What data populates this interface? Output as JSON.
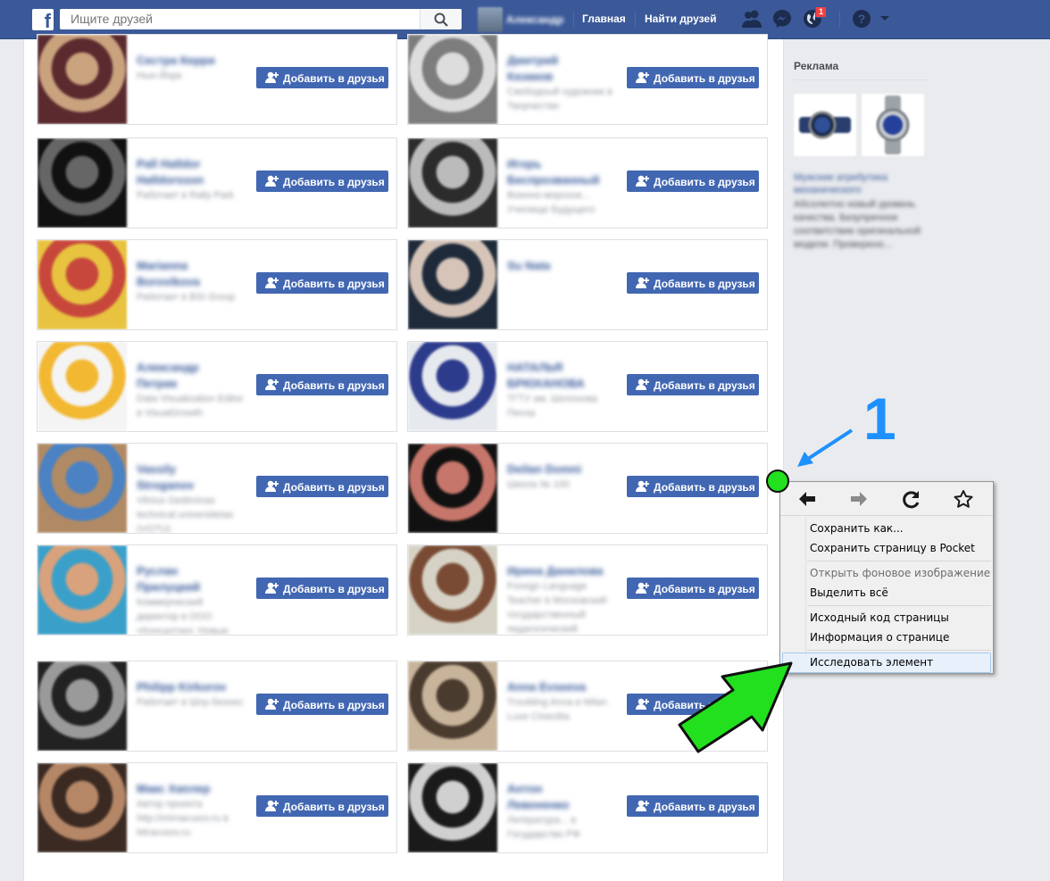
{
  "header": {
    "logo_letter": "f",
    "search_placeholder": "Ищите друзей",
    "profile_name": "Александр",
    "nav_home": "Главная",
    "nav_find_friends": "Найти друзей",
    "notifications_count": "1"
  },
  "add_button_label": "Добавить в друзья",
  "people_left": [
    {
      "name": "Сестра Керри",
      "subtitle": "Нью-Йорк",
      "photo_colors": [
        "#5b2a2e",
        "#c9a27e"
      ]
    },
    {
      "name": "Pall Halldor Halldorsson",
      "subtitle": "Работает в Rally Park",
      "photo_colors": [
        "#111111",
        "#666666"
      ]
    },
    {
      "name": "Marianna Borovikova",
      "subtitle": "Работает в BSI Group",
      "photo_colors": [
        "#e7c33f",
        "#c8473c"
      ]
    },
    {
      "name": "Александр Петрик",
      "subtitle": "Data Visualization Editor в VisualGrowth",
      "photo_colors": [
        "#f4f4f4",
        "#f2b832"
      ]
    },
    {
      "name": "Vassily Stroganov",
      "subtitle": "Vilnius Gediminas technical universitetas (VGTU)",
      "photo_colors": [
        "#b08a64",
        "#4a82c4"
      ]
    },
    {
      "name": "Руслан Прилуцкий",
      "subtitle": "Коммерческий директор в ООО «Консалтинг. Новые управленческие технологии»",
      "photo_colors": [
        "#3aa0c9",
        "#d8a27c"
      ]
    },
    {
      "name": "Philipp Kirkorov",
      "subtitle": "Работает в Шоу-бизнес",
      "photo_colors": [
        "#222222",
        "#9a9a9a"
      ]
    },
    {
      "name": "Макс Хаплер",
      "subtitle": "Автор проекта http://mirnarusov.ru в Mirarusov.ru",
      "photo_colors": [
        "#3b2a22",
        "#b58767"
      ]
    }
  ],
  "people_right": [
    {
      "name": "Дмитрий Казаков",
      "subtitle": "Свободный художник в Творчество",
      "photo_colors": [
        "#7d7d7d",
        "#dddddd"
      ]
    },
    {
      "name": "Игорь Беспрозванный",
      "subtitle": "Военно-морское... Училище Будущего",
      "photo_colors": [
        "#2c2c2c",
        "#bbbbbb"
      ]
    },
    {
      "name": "Su Nata",
      "subtitle": "",
      "photo_colors": [
        "#1e2a3a",
        "#d6c4b8"
      ]
    },
    {
      "name": "НАТАЛЬЯ БРЮХАНОВА",
      "subtitle": "ТГТУ им. Шолохова Пенза",
      "photo_colors": [
        "#e6e9ee",
        "#2d3b8c"
      ]
    },
    {
      "name": "Deilan Domni",
      "subtitle": "Школа № 100",
      "photo_colors": [
        "#111111",
        "#c6766a"
      ]
    },
    {
      "name": "Ирина Данилова",
      "subtitle": "Foreign Language Teacher в Московский государственный педагогический университет",
      "photo_colors": [
        "#d6d3c6",
        "#7a4b34"
      ]
    },
    {
      "name": "Anna Evseeva",
      "subtitle": "Troubling Anna в Milan Luxe Cinecitta",
      "photo_colors": [
        "#c8b49a",
        "#4a3b2f"
      ]
    },
    {
      "name": "Антон Левоненко",
      "subtitle": "Литература... в Государство РФ",
      "photo_colors": [
        "#1a1a1a",
        "#d0d0d0"
      ]
    }
  ],
  "ads": {
    "title": "Реклама",
    "ad_title": "Мужские атрибутика механического",
    "ad_text": "Абсолютно новый уровень качества. Безупречное соответствие оригинальной модели. Проверено..."
  },
  "context_menu": {
    "items": {
      "save_as": "Сохранить как...",
      "save_pocket": "Сохранить страницу в Pocket",
      "open_bg": "Открыть фоновое изображение",
      "select_all": "Выделить всё",
      "view_source": "Исходный код страницы",
      "page_info": "Информация о странице",
      "inspect": "Исследовать элемент"
    }
  },
  "annotation": {
    "step_number": "1",
    "pointer_color": "#1e90ff",
    "marker_color": "#22e01e"
  }
}
